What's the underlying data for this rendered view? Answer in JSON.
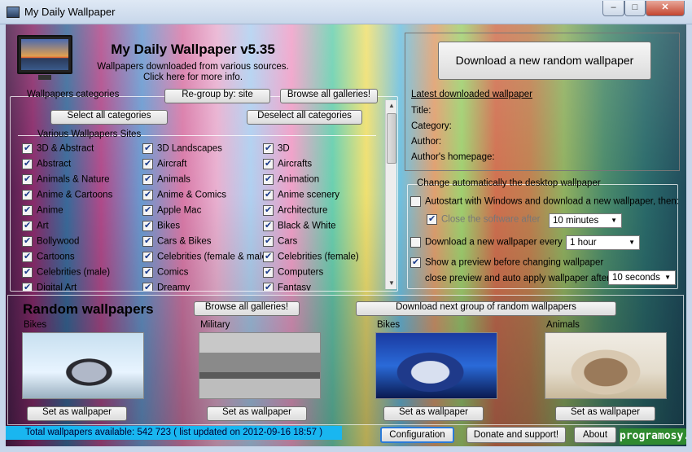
{
  "window": {
    "title": "My Daily Wallpaper",
    "min_glyph": "–",
    "max_glyph": "□",
    "close_glyph": "✕"
  },
  "header": {
    "title": "My Daily Wallpaper v5.35",
    "subtitle1": "Wallpapers downloaded from various sources.",
    "subtitle2": "Click here for more info."
  },
  "categories": {
    "legend": "Wallpapers categories",
    "regroup_label": "Re-group by: site",
    "browse_all_label": "Browse all galleries!",
    "select_all_label": "Select all categories",
    "deselect_all_label": "Deselect all categories",
    "sites_legend": "Various Wallpapers Sites",
    "columns": [
      [
        "3D & Abstract",
        "Abstract",
        "Animals & Nature",
        "Anime & Cartoons",
        "Anime",
        "Art",
        "Bollywood",
        "Cartoons",
        "Celebrities (male)",
        "Digital Art"
      ],
      [
        "3D Landscapes",
        "Aircraft",
        "Animals",
        "Anime & Comics",
        "Apple Mac",
        "Bikes",
        "Cars & Bikes",
        "Celebrities (female & male)",
        "Comics",
        "Dreamy"
      ],
      [
        "3D",
        "Aircrafts",
        "Animation",
        "Anime scenery",
        "Architecture",
        "Black & White",
        "Cars",
        "Celebrities (female)",
        "Computers",
        "Fantasy"
      ]
    ]
  },
  "latest": {
    "download_button": "Download a new random wallpaper",
    "link": "Latest downloaded wallpaper",
    "title_label": "Title:",
    "category_label": "Category:",
    "author_label": "Author:",
    "homepage_label": "Author's homepage:"
  },
  "auto": {
    "legend": "Change automatically the desktop wallpaper",
    "autostart_label": "Autostart with Windows and download a new wallpaper, then:",
    "close_label": "Close the software after",
    "close_value": "10 minutes",
    "every_label": "Download a new wallpaper every",
    "every_value": "1 hour",
    "preview_label": "Show a preview before changing wallpaper",
    "preview_close_label": "close preview and auto apply wallpaper after",
    "preview_value": "10 seconds"
  },
  "random": {
    "title": "Random wallpapers",
    "browse_all_label": "Browse all galleries!",
    "download_group_label": "Download next group of random wallpapers",
    "set_label": "Set as wallpaper",
    "items": [
      {
        "category": "Bikes"
      },
      {
        "category": "Military"
      },
      {
        "category": "Bikes"
      },
      {
        "category": "Animals"
      }
    ]
  },
  "status": {
    "total_text": "Total wallpapers available: 542 723 ( list updated on 2012-09-16 18:57 )",
    "configuration_label": "Configuration",
    "donate_label": "Donate and support!",
    "about_label": "About",
    "badge_text": "programosy.pl"
  },
  "colors": {
    "status_bar": "#19b6f0",
    "badge": "#2f8a2f"
  }
}
